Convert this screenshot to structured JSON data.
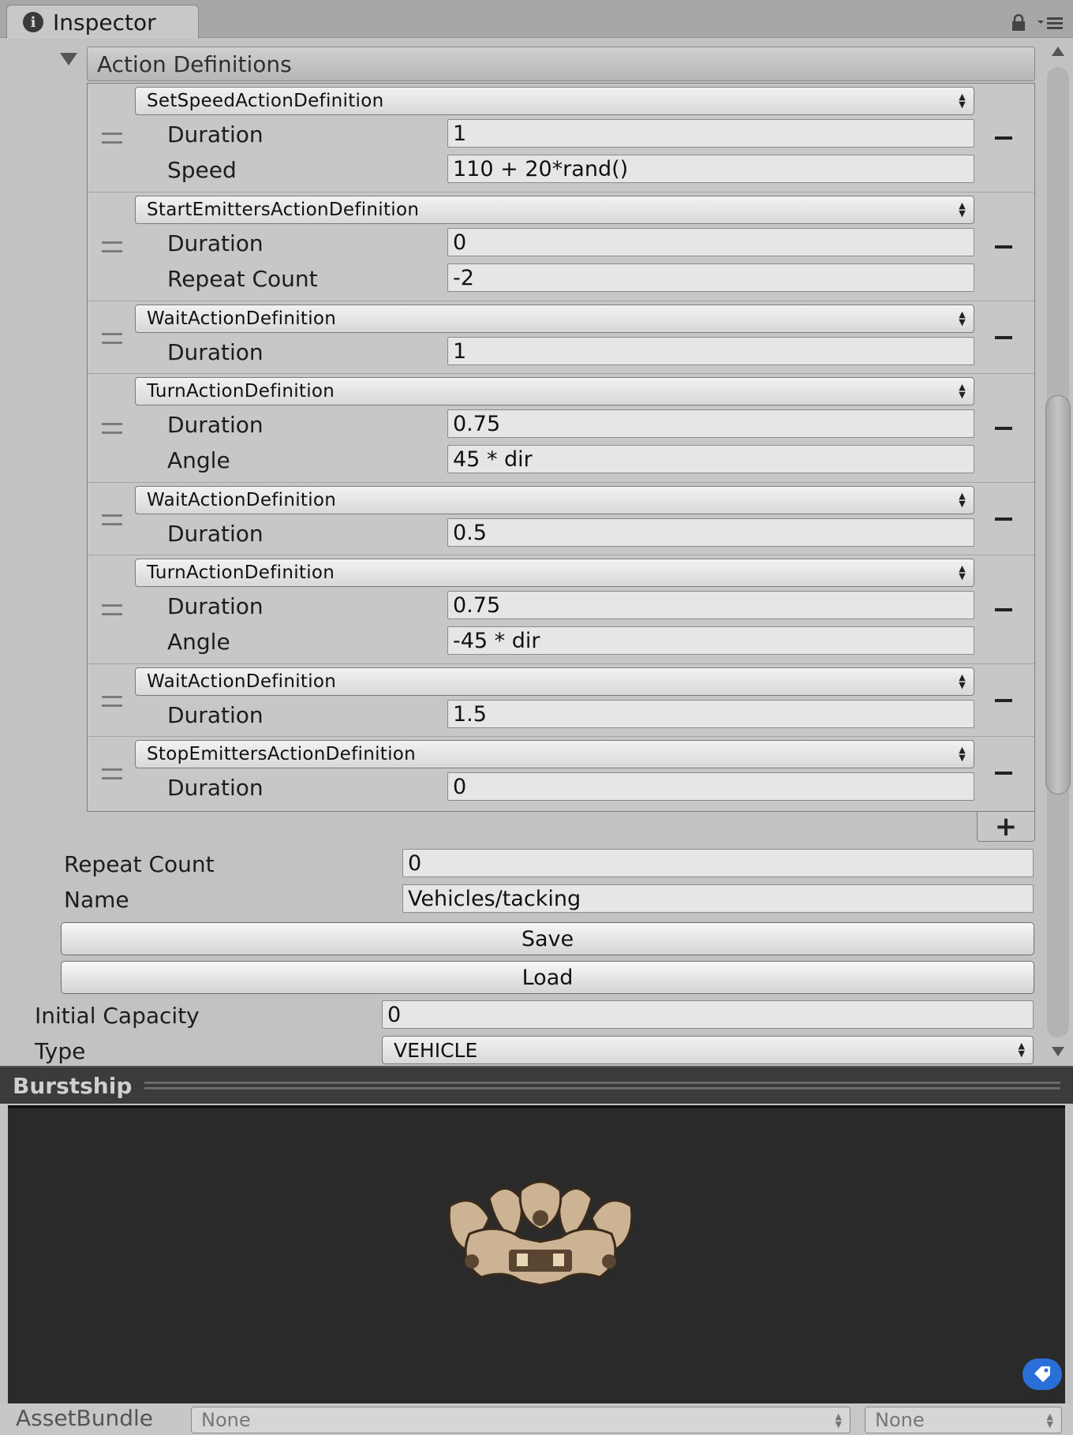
{
  "tab": {
    "title": "Inspector"
  },
  "action_definitions": {
    "header": "Action Definitions",
    "items": [
      {
        "type": "SetSpeedActionDefinition",
        "fields": [
          {
            "label": "Duration",
            "value": "1"
          },
          {
            "label": "Speed",
            "value": "110 + 20*rand()"
          }
        ]
      },
      {
        "type": "StartEmittersActionDefinition",
        "fields": [
          {
            "label": "Duration",
            "value": "0"
          },
          {
            "label": "Repeat Count",
            "value": "-2"
          }
        ]
      },
      {
        "type": "WaitActionDefinition",
        "fields": [
          {
            "label": "Duration",
            "value": "1"
          }
        ]
      },
      {
        "type": "TurnActionDefinition",
        "fields": [
          {
            "label": "Duration",
            "value": "0.75"
          },
          {
            "label": "Angle",
            "value": "45 * dir"
          }
        ]
      },
      {
        "type": "WaitActionDefinition",
        "fields": [
          {
            "label": "Duration",
            "value": "0.5"
          }
        ]
      },
      {
        "type": "TurnActionDefinition",
        "fields": [
          {
            "label": "Duration",
            "value": "0.75"
          },
          {
            "label": "Angle",
            "value": "-45 * dir"
          }
        ]
      },
      {
        "type": "WaitActionDefinition",
        "fields": [
          {
            "label": "Duration",
            "value": "1.5"
          }
        ]
      },
      {
        "type": "StopEmittersActionDefinition",
        "fields": [
          {
            "label": "Duration",
            "value": "0"
          }
        ]
      }
    ],
    "add_symbol": "+",
    "remove_symbol": "−"
  },
  "properties": {
    "repeat_count_label": "Repeat Count",
    "repeat_count_value": "0",
    "name_label": "Name",
    "name_value": "Vehicles/tacking",
    "save_label": "Save",
    "load_label": "Load",
    "initial_capacity_label": "Initial Capacity",
    "initial_capacity_value": "0",
    "type_label": "Type",
    "type_value": "VEHICLE"
  },
  "preview": {
    "title": "Burstship"
  },
  "asset_bundle": {
    "label": "AssetBundle",
    "bundle_value": "None",
    "variant_value": "None"
  },
  "icons": [
    "info-icon",
    "lock-icon",
    "menu-icon",
    "drag-handle-icon",
    "tag-icon"
  ],
  "colors": {
    "tag_button": "#2a6ed8",
    "preview_bg": "#2a2a2a",
    "panel_bg": "#c2c2c2"
  }
}
